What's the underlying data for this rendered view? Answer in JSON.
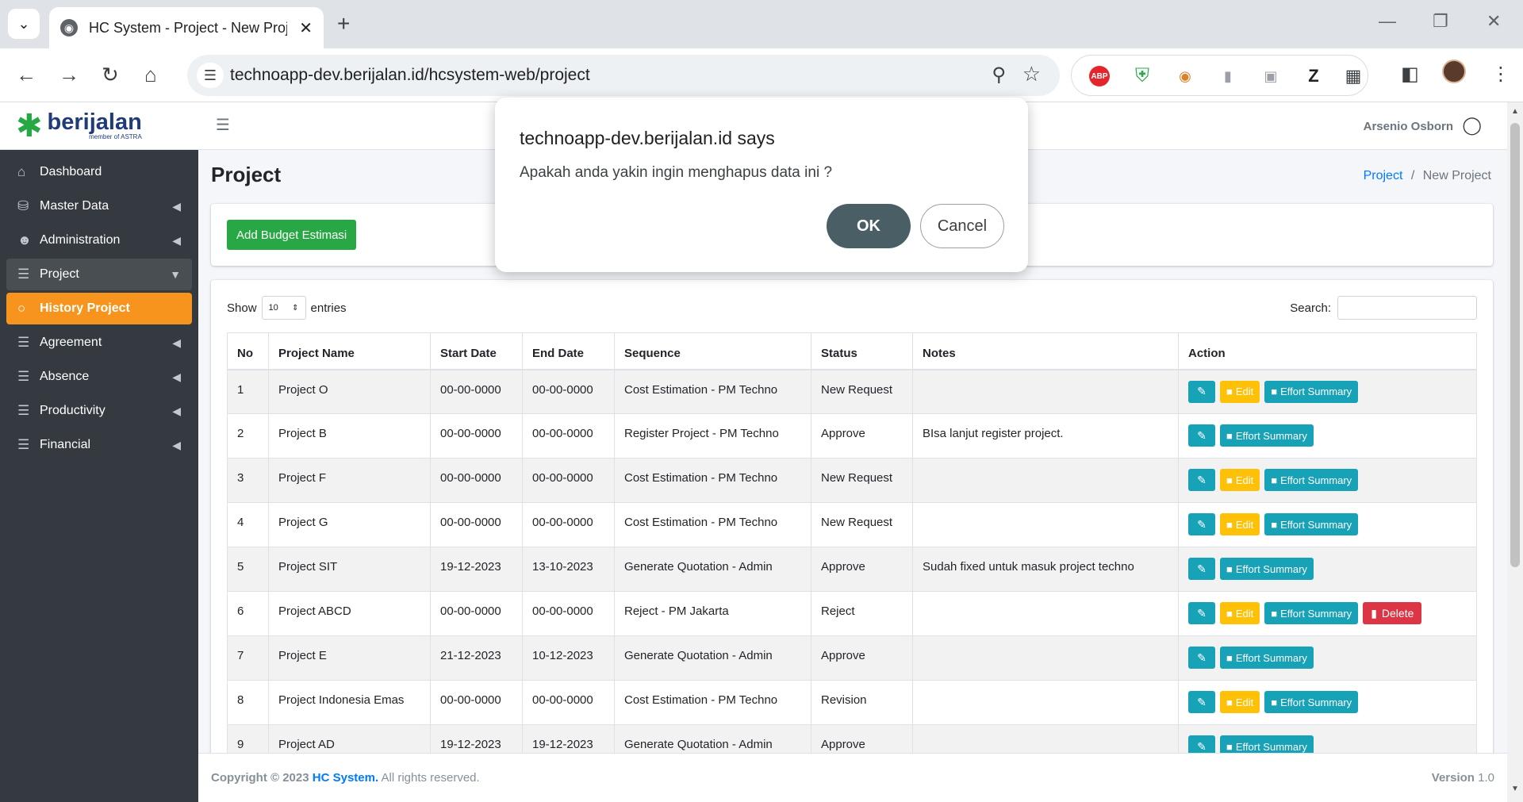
{
  "browser": {
    "tab_title": "HC System - Project - New Project",
    "url": "technoapp-dev.berijalan.id/hcsystem-web/project",
    "abp_label": "ABP",
    "ext_z": "Z"
  },
  "brand": {
    "name": "berijalan",
    "sub": "member of ASTRA"
  },
  "sidebar": {
    "items": [
      {
        "label": "Dashboard",
        "icon": "home-icon"
      },
      {
        "label": "Master Data",
        "icon": "database-icon"
      },
      {
        "label": "Administration",
        "icon": "users-icon"
      },
      {
        "label": "Project",
        "icon": "list-icon"
      },
      {
        "label": "History Project",
        "icon": "circle-icon"
      },
      {
        "label": "Agreement",
        "icon": "list-icon"
      },
      {
        "label": "Absence",
        "icon": "list-icon"
      },
      {
        "label": "Productivity",
        "icon": "list-icon"
      },
      {
        "label": "Financial",
        "icon": "list-icon"
      }
    ]
  },
  "header": {
    "user": "Arsenio Osborn"
  },
  "page": {
    "title": "Project",
    "breadcrumb_link": "Project",
    "breadcrumb_sep": "/",
    "breadcrumb_current": "New Project",
    "add_button": "Add Budget Estimasi"
  },
  "table": {
    "show_label": "Show",
    "entries_value": "10",
    "entries_label": "entries",
    "search_label": "Search:",
    "columns": [
      "No",
      "Project Name",
      "Start Date",
      "End Date",
      "Sequence",
      "Status",
      "Notes",
      "Action"
    ],
    "rows": [
      {
        "no": "1",
        "name": "Project O",
        "start": "00-00-0000",
        "end": "00-00-0000",
        "sequence": "Cost Estimation - PM Techno",
        "status": "New Request",
        "notes": "",
        "edit": true,
        "delete": false
      },
      {
        "no": "2",
        "name": "Project B",
        "start": "00-00-0000",
        "end": "00-00-0000",
        "sequence": "Register Project - PM Techno",
        "status": "Approve",
        "notes": "BIsa lanjut register project.",
        "edit": false,
        "delete": false
      },
      {
        "no": "3",
        "name": "Project F",
        "start": "00-00-0000",
        "end": "00-00-0000",
        "sequence": "Cost Estimation - PM Techno",
        "status": "New Request",
        "notes": "",
        "edit": true,
        "delete": false
      },
      {
        "no": "4",
        "name": "Project G",
        "start": "00-00-0000",
        "end": "00-00-0000",
        "sequence": "Cost Estimation - PM Techno",
        "status": "New Request",
        "notes": "",
        "edit": true,
        "delete": false
      },
      {
        "no": "5",
        "name": "Project SIT",
        "start": "19-12-2023",
        "end": "13-10-2023",
        "sequence": "Generate Quotation - Admin",
        "status": "Approve",
        "notes": "Sudah fixed untuk masuk project techno",
        "edit": false,
        "delete": false
      },
      {
        "no": "6",
        "name": "Project ABCD",
        "start": "00-00-0000",
        "end": "00-00-0000",
        "sequence": "Reject - PM Jakarta",
        "status": "Reject",
        "notes": "",
        "edit": true,
        "delete": true
      },
      {
        "no": "7",
        "name": "Project E",
        "start": "21-12-2023",
        "end": "10-12-2023",
        "sequence": "Generate Quotation - Admin",
        "status": "Approve",
        "notes": "",
        "edit": false,
        "delete": false
      },
      {
        "no": "8",
        "name": "Project Indonesia Emas",
        "start": "00-00-0000",
        "end": "00-00-0000",
        "sequence": "Cost Estimation - PM Techno",
        "status": "Revision",
        "notes": "",
        "edit": true,
        "delete": false
      },
      {
        "no": "9",
        "name": "Project AD",
        "start": "19-12-2023",
        "end": "19-12-2023",
        "sequence": "Generate Quotation - Admin",
        "status": "Approve",
        "notes": "",
        "edit": false,
        "delete": false
      }
    ],
    "action_labels": {
      "edit": "Edit",
      "effort": "Effort Summary",
      "delete": "Delete"
    }
  },
  "footer": {
    "copyright_prefix": "Copyright © 2023",
    "app_name": "HC System.",
    "rights": "All rights reserved.",
    "version_label": "Version",
    "version_value": "1.0"
  },
  "dialog": {
    "title": "technoapp-dev.berijalan.id says",
    "message": "Apakah anda yakin ingin menghapus data ini ?",
    "ok": "OK",
    "cancel": "Cancel"
  }
}
